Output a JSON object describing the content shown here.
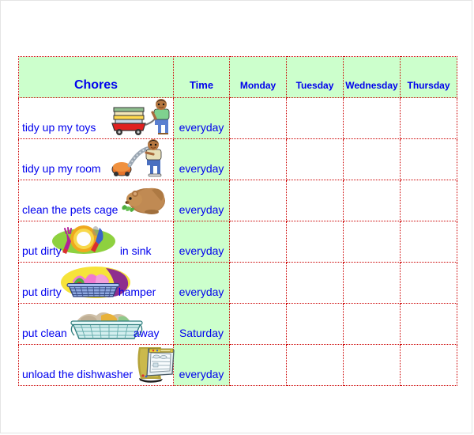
{
  "table": {
    "headers": {
      "chores": "Chores",
      "time": "Time",
      "days": [
        "Monday",
        "Tuesday",
        "Wednesday",
        "Thursday"
      ]
    },
    "rows": [
      {
        "text_before": "tidy up my toys",
        "text_after": "",
        "icon": "toy-wagon-boy-icon",
        "time": "everyday",
        "days": [
          "",
          "",
          "",
          ""
        ]
      },
      {
        "text_before": "tidy up my room",
        "text_after": "",
        "icon": "vacuum-boy-icon",
        "time": "everyday",
        "days": [
          "",
          "",
          "",
          ""
        ]
      },
      {
        "text_before": "clean the pets cage",
        "text_after": "",
        "icon": "hamster-icon",
        "time": "everyday",
        "days": [
          "",
          "",
          "",
          ""
        ]
      },
      {
        "text_before": "put dirty",
        "text_after": "in sink",
        "icon": "dirty-dishes-icon",
        "time": "everyday",
        "days": [
          "",
          "",
          "",
          ""
        ]
      },
      {
        "text_before": "put dirty",
        "text_after": "hamper",
        "icon": "laundry-hamper-icon",
        "time": "everyday",
        "days": [
          "",
          "",
          "",
          ""
        ]
      },
      {
        "text_before": "put clean",
        "text_after": "away",
        "icon": "clean-laundry-basket-icon",
        "time": "Saturday",
        "days": [
          "",
          "",
          "",
          ""
        ]
      },
      {
        "text_before": "unload the dishwasher",
        "text_after": "",
        "icon": "dishwasher-icon",
        "time": "everyday",
        "days": [
          "",
          "",
          "",
          ""
        ]
      }
    ]
  },
  "colors": {
    "header_fill": "#ccffcc",
    "time_fill": "#ccffcc",
    "grid_line": "#cc0000",
    "text": "#0000ee",
    "page_border": "#e4e4e4",
    "background": "#ffffff"
  }
}
